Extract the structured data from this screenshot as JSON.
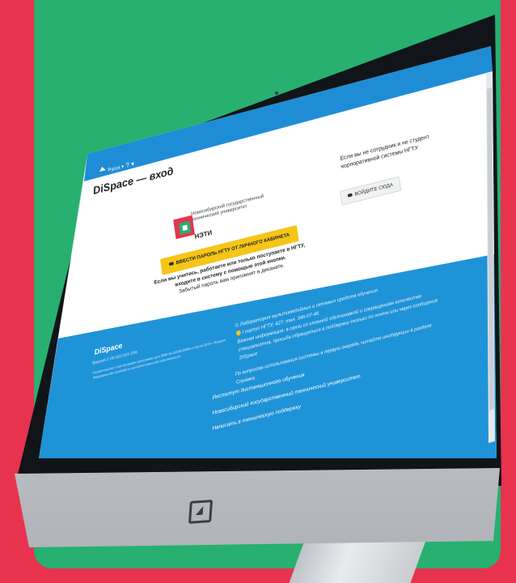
{
  "nav": {
    "home_icon": "home-icon",
    "lang_label": "Русск ▾",
    "help_label": "? ▾"
  },
  "page": {
    "title": "DiSpace — вход"
  },
  "university": {
    "name_line1": "Новосибирский государственный",
    "name_line2": "технический университет",
    "short": "НЭТИ",
    "logo_colors": [
      "#e8334f",
      "#27b06f"
    ]
  },
  "login": {
    "button_label": "ВВЕСТИ ПАРОЛЬ НГТУ ОТ ЛИЧНОГО КАБИНЕТА",
    "hint_line1": "Если вы учитесь, работаете или только поступаете в НГТУ,",
    "hint_line2": "входите в систему с помощью этой кнопки.",
    "hint_line3": "Забытый пароль вам припомнят в деканате."
  },
  "guest": {
    "line1": "Если вы не сотрудник и не студент",
    "line2": "корпоративной системы НГТУ",
    "button_label": "ВОЙДИТЕ СЮДА"
  },
  "footer": {
    "title": "DiSpace",
    "version": "Версия 2.00.022.001.036",
    "reg_line1": "Свидетельство о регистрации программы для ЭВМ № 2018618956 от 08.04.2019 г. Выдано",
    "reg_line2": "Федеральной службой по интеллектуальной собственности",
    "lab_line1": "© Лаборатория мультимедийных и сетевых средств обучения",
    "lab_line2": "I корпус НГТУ, 427, тел. 346-07-46",
    "lab_line3": "Важная информация: в связи со сложной обстановкой и сокращением количества",
    "lab_line4": "специалистов, просьба обращаться в поддержку только по почте или через сообщения",
    "lab_line5": "DiSpace",
    "usage_line1": "По вопросам использования системы в первую очередь читайте инструкции в разделе",
    "usage_line2": "Справка",
    "link1": "Институт дистанционного обучения",
    "link2": "Новосибирский государственный технический университет",
    "link3": "Написать в техническую поддержку"
  },
  "colors": {
    "background_red": "#e8334f",
    "background_green": "#27b06f",
    "topbar_blue": "#1f8dd6",
    "footer_blue": "#1f93d8",
    "button_yellow": "#f5c518"
  }
}
